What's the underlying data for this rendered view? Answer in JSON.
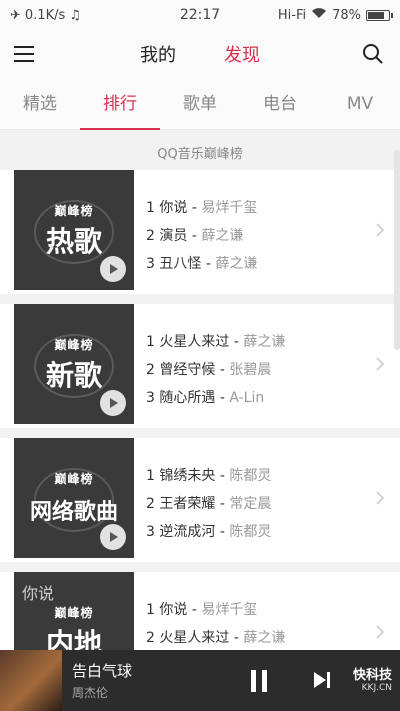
{
  "status_bar": {
    "speed": "0.1K/s",
    "time": "22:17",
    "network": "Hi-Fi",
    "battery": "78%",
    "battery_level": 0.78
  },
  "header": {
    "mine": "我的",
    "discover": "发现"
  },
  "subtabs": [
    {
      "label": "精选"
    },
    {
      "label": "排行"
    },
    {
      "label": "歌单"
    },
    {
      "label": "电台"
    },
    {
      "label": "MV"
    }
  ],
  "section": {
    "title": "QQ音乐巅峰榜"
  },
  "charts": [
    {
      "brand": "巅峰榜",
      "name": "热歌",
      "tracks": [
        {
          "n": "1",
          "song": "你说",
          "artist": "易烊千玺"
        },
        {
          "n": "2",
          "song": "演员",
          "artist": "薛之谦"
        },
        {
          "n": "3",
          "song": "丑八怪",
          "artist": "薛之谦"
        }
      ]
    },
    {
      "brand": "巅峰榜",
      "name": "新歌",
      "tracks": [
        {
          "n": "1",
          "song": "火星人来过",
          "artist": "薛之谦"
        },
        {
          "n": "2",
          "song": "曾经守候",
          "artist": "张碧晨"
        },
        {
          "n": "3",
          "song": "随心所遇",
          "artist": "A-Lin"
        }
      ]
    },
    {
      "brand": "巅峰榜",
      "name": "网络歌曲",
      "tracks": [
        {
          "n": "1",
          "song": "锦绣未央",
          "artist": "陈都灵"
        },
        {
          "n": "2",
          "song": "王者荣耀",
          "artist": "常定晨"
        },
        {
          "n": "3",
          "song": "逆流成河",
          "artist": "陈都灵"
        }
      ]
    },
    {
      "brand": "巅峰榜",
      "name": "内地",
      "tracks": [
        {
          "n": "1",
          "song": "你说",
          "artist": "易烊千玺"
        },
        {
          "n": "2",
          "song": "火星人来过",
          "artist": "薛之谦"
        }
      ]
    }
  ],
  "player": {
    "song": "告白气球",
    "singer": "周杰伦"
  },
  "watermark": {
    "name": "快科技",
    "domain": "KKJ.CN"
  }
}
